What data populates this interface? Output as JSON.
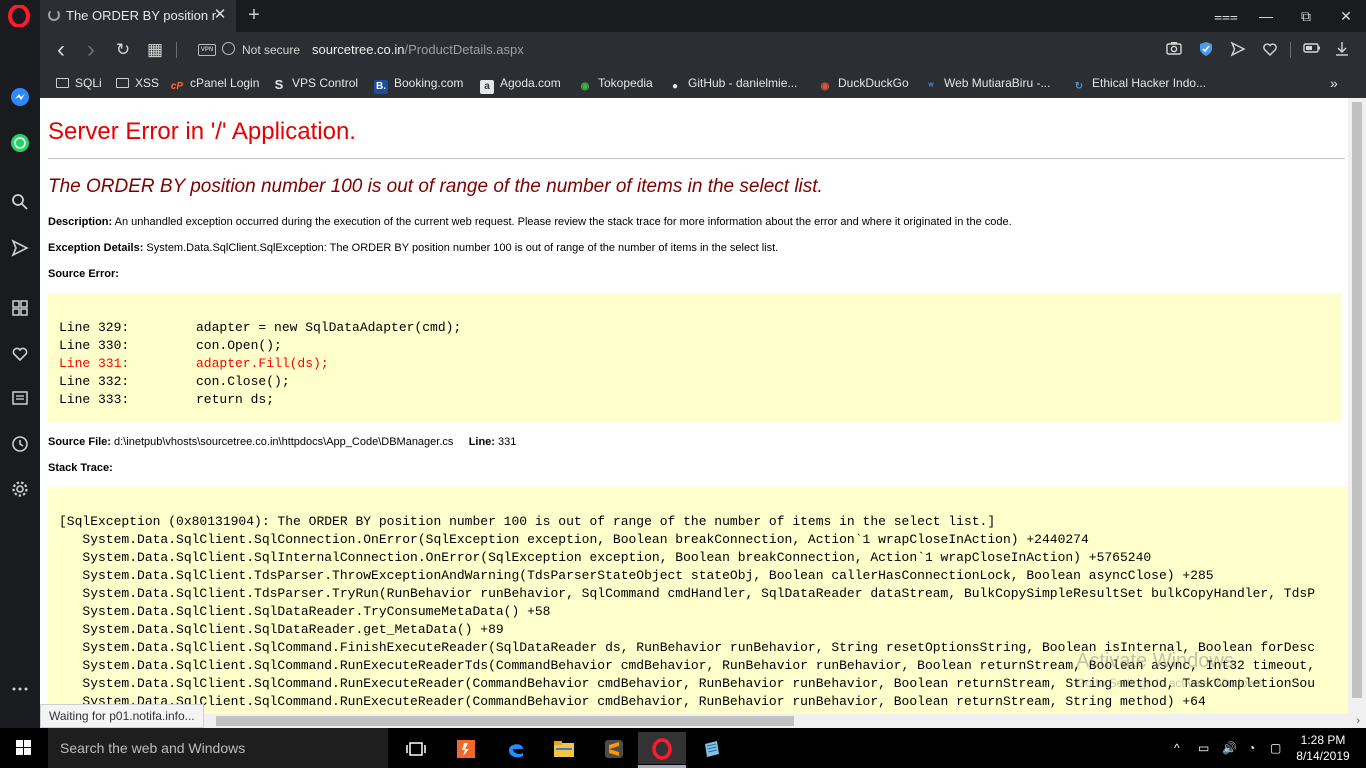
{
  "browser": {
    "tab": {
      "title": "The ORDER BY position nu",
      "close": "✕"
    },
    "new_tab": "+",
    "window_controls": {
      "menu": "⩶",
      "minimize": "—",
      "restore": "⧉",
      "close": "✕"
    },
    "nav": {
      "back": "‹",
      "forward": "›",
      "reload": "↻",
      "tabs": "▦"
    },
    "security": {
      "vpn": "VPN",
      "label": "Not secure"
    },
    "url": {
      "host": "sourcetree.co.in",
      "path": "/ProductDetails.aspx"
    },
    "bookmarks": [
      {
        "label": "SQLi",
        "icon": "folder-icon"
      },
      {
        "label": "XSS",
        "icon": "folder-icon"
      },
      {
        "label": "cPanel Login",
        "icon": "cpanel-icon",
        "glyph": "cP",
        "color": "#ff6c2c"
      },
      {
        "label": "VPS Control",
        "icon": "vps-icon",
        "glyph": "S",
        "color": "#e6e6e6"
      },
      {
        "label": "Booking.com",
        "icon": "booking-icon",
        "glyph": "B.",
        "color": "#1a4fa0"
      },
      {
        "label": "Agoda.com",
        "icon": "agoda-icon",
        "glyph": "a",
        "color": "#e6e6e6"
      },
      {
        "label": "Tokopedia",
        "icon": "tokopedia-icon",
        "glyph": "◉",
        "color": "#42b549"
      },
      {
        "label": "GitHub - danielmie...",
        "icon": "github-icon",
        "glyph": "●",
        "color": "#e6e6e6"
      },
      {
        "label": "DuckDuckGo",
        "icon": "duckduckgo-icon",
        "glyph": "◉",
        "color": "#de5833"
      },
      {
        "label": "Web MutiaraBiru -...",
        "icon": "wordpress-icon",
        "glyph": "ʷ",
        "color": "#4a90d9"
      },
      {
        "label": "Ethical Hacker Indo...",
        "icon": "ethical-hacker-icon",
        "glyph": "↻",
        "color": "#4a90d9"
      }
    ],
    "bookmarks_more": "»",
    "status_text": "Waiting for p01.notifa.info..."
  },
  "page": {
    "title": "Server Error in '/' Application.",
    "message": "The ORDER BY position number 100 is out of range of the number of items in the select list.",
    "description_label": "Description:",
    "description": "An unhandled exception occurred during the execution of the current web request. Please review the stack trace for more information about the error and where it originated in the code.",
    "exception_label": "Exception Details:",
    "exception": "System.Data.SqlClient.SqlException: The ORDER BY position number 100 is out of range of the number of items in the select list.",
    "source_error_label": "Source Error:",
    "source_lines": [
      {
        "num": "Line 329:",
        "code": "adapter = new SqlDataAdapter(cmd);",
        "error": false
      },
      {
        "num": "Line 330:",
        "code": "con.Open();",
        "error": false
      },
      {
        "num": "Line 331:",
        "code": "adapter.Fill(ds);",
        "error": true
      },
      {
        "num": "Line 332:",
        "code": "con.Close();",
        "error": false
      },
      {
        "num": "Line 333:",
        "code": "return ds;",
        "error": false
      }
    ],
    "source_file_label": "Source File:",
    "source_file": "d:\\inetpub\\vhosts\\sourcetree.co.in\\httpdocs\\App_Code\\DBManager.cs",
    "line_label": "Line:",
    "line": "331",
    "stack_trace_label": "Stack Trace:",
    "stack_trace": [
      "[SqlException (0x80131904): The ORDER BY position number 100 is out of range of the number of items in the select list.]",
      "   System.Data.SqlClient.SqlConnection.OnError(SqlException exception, Boolean breakConnection, Action`1 wrapCloseInAction) +2440274",
      "   System.Data.SqlClient.SqlInternalConnection.OnError(SqlException exception, Boolean breakConnection, Action`1 wrapCloseInAction) +5765240",
      "   System.Data.SqlClient.TdsParser.ThrowExceptionAndWarning(TdsParserStateObject stateObj, Boolean callerHasConnectionLock, Boolean asyncClose) +285",
      "   System.Data.SqlClient.TdsParser.TryRun(RunBehavior runBehavior, SqlCommand cmdHandler, SqlDataReader dataStream, BulkCopySimpleResultSet bulkCopyHandler, TdsP",
      "   System.Data.SqlClient.SqlDataReader.TryConsumeMetaData() +58",
      "   System.Data.SqlClient.SqlDataReader.get_MetaData() +89",
      "   System.Data.SqlClient.SqlCommand.FinishExecuteReader(SqlDataReader ds, RunBehavior runBehavior, String resetOptionsString, Boolean isInternal, Boolean forDesc",
      "   System.Data.SqlClient.SqlCommand.RunExecuteReaderTds(CommandBehavior cmdBehavior, RunBehavior runBehavior, Boolean returnStream, Boolean async, Int32 timeout,",
      "   System.Data.SqlClient.SqlCommand.RunExecuteReader(CommandBehavior cmdBehavior, RunBehavior runBehavior, Boolean returnStream, String method, TaskCompletionSou",
      "   System.Data.SqlClient.SqlCommand.RunExecuteReader(CommandBehavior cmdBehavior, RunBehavior runBehavior, Boolean returnStream, String method) +64"
    ]
  },
  "watermark": {
    "line1": "Activate Windows",
    "line2": "Go to Settings to activate Windows."
  },
  "taskbar": {
    "search_placeholder": "Search the web and Windows",
    "time": "1:28 PM",
    "date": "8/14/2019",
    "tray": {
      "chevron": "^",
      "battery": "▭",
      "volume": "🔊",
      "wifi": "◔",
      "notifications": "▢"
    }
  },
  "colors": {
    "error_title": "#e60000",
    "error_message": "#800000",
    "code_bg": "#ffffcc",
    "error_line": "#ff0000",
    "opera_red": "#ff1b2d"
  }
}
